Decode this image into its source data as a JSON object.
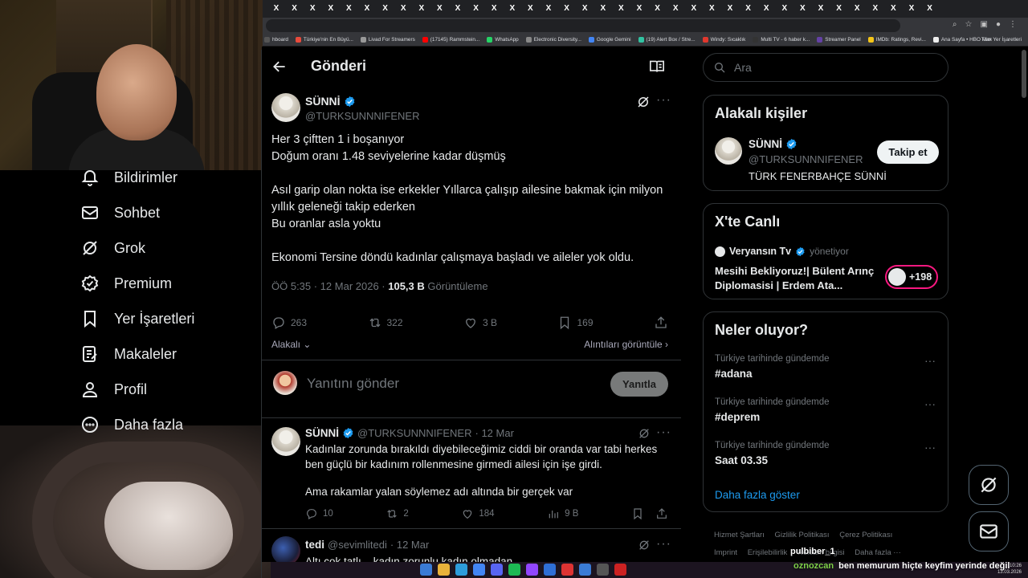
{
  "browser": {
    "tab_glyph": "X",
    "bookmarks": [
      {
        "label": "hboard",
        "color": "#555"
      },
      {
        "label": "Türkiye'nin En Büyü...",
        "color": "#e94b3c"
      },
      {
        "label": "Livad For Streamers",
        "color": "#999"
      },
      {
        "label": "(17145) Rammstein...",
        "color": "#ff0000"
      },
      {
        "label": "WhatsApp",
        "color": "#25d366"
      },
      {
        "label": "Electronic Diversity...",
        "color": "#888"
      },
      {
        "label": "Google Gemini",
        "color": "#4285f4"
      },
      {
        "label": "(19) Alert Box / Stre...",
        "color": "#31c3a2"
      },
      {
        "label": "Windy: Sıcaklık",
        "color": "#e0382e"
      },
      {
        "label": "Multi TV - 6 haber k...",
        "color": "#333"
      },
      {
        "label": "Streamer Panel",
        "color": "#6441a5"
      },
      {
        "label": "IMDb: Ratings, Revi...",
        "color": "#f5c518"
      },
      {
        "label": "Ana Sayfa • HBO Max",
        "color": "#eee"
      }
    ],
    "all_bookmarks": "Tüm Yer İşaretleri"
  },
  "left_nav": {
    "items": [
      {
        "label": "Bildirimler",
        "icon": "bell-icon"
      },
      {
        "label": "Sohbet",
        "icon": "mail-icon"
      },
      {
        "label": "Grok",
        "icon": "grok-icon"
      },
      {
        "label": "Premium",
        "icon": "premium-icon"
      },
      {
        "label": "Yer İşaretleri",
        "icon": "bookmark-icon"
      },
      {
        "label": "Makaleler",
        "icon": "article-icon"
      },
      {
        "label": "Profil",
        "icon": "profile-icon"
      },
      {
        "label": "Daha fazla",
        "icon": "more-circle-icon"
      }
    ]
  },
  "main": {
    "header": {
      "title": "Gönderi"
    },
    "post": {
      "name": "SÜNNİ",
      "handle": "@TURKSUNNNIFENER",
      "paragraphs": [
        "Her 3 çiftten 1 i boşanıyor\nDoğum oranı 1.48 seviyelerine kadar düşmüş",
        "Asıl garip olan nokta ise erkekler Yıllarca çalışıp ailesine bakmak için milyon yıllık geleneği takip ederken\nBu oranlar asla yoktu",
        "Ekonomi Tersine döndü kadınlar çalışmaya başladı ve aileler yok oldu."
      ],
      "time": "ÖÖ 5:35 · 12 Mar 2026 · ",
      "views": "105,3 B",
      "views_label": " Görüntüleme",
      "replies": "263",
      "reposts": "322",
      "likes": "3 B",
      "bookmarks": "169",
      "related": "Alakalı",
      "quotes": "Alıntıları görüntüle"
    },
    "reply_box": {
      "placeholder": "Yanıtını gönder",
      "button": "Yanıtla"
    },
    "replies": [
      {
        "name": "SÜNNİ",
        "handle": "@TURKSUNNNIFENER",
        "date": "· 12 Mar",
        "paragraphs": [
          "Kadınlar zorunda bırakıldı diyebileceğimiz ciddi bir oranda var tabi herkes ben güçlü bir kadınım rollenmesine girmedi ailesi için işe girdi.",
          "Ama rakamlar yalan söylemez adı altında bir gerçek var"
        ],
        "replies": "10",
        "reposts": "2",
        "likes": "184",
        "views": "9 B"
      },
      {
        "name": "tedi",
        "handle": "@sevimlitedi",
        "date": "· 12 Mar",
        "paragraphs": [
          "Altı çok tatlı... kadın zorunlu kadın olmadan..."
        ]
      }
    ]
  },
  "right": {
    "search_placeholder": "Ara",
    "related_people": {
      "title": "Alakalı kişiler",
      "name": "SÜNNİ",
      "handle": "@TURKSUNNNIFENER",
      "bio": "TÜRK FENERBAHÇE SÜNNİ",
      "follow": "Takip et"
    },
    "live": {
      "title": "X'te Canlı",
      "host": "Veryansın Tv",
      "host_role": "yönetiyor",
      "stream_title": "Mesihi Bekliyoruz!| Bülent Arınç Diplomasisi | Erdem Ata...",
      "listeners": "+198"
    },
    "trends": {
      "title": "Neler oluyor?",
      "items": [
        {
          "context": "Türkiye tarihinde gündemde",
          "name": "#adana"
        },
        {
          "context": "Türkiye tarihinde gündemde",
          "name": "#deprem"
        },
        {
          "context": "Türkiye tarihinde gündemde",
          "name": "Saat 03.35"
        }
      ],
      "show_more": "Daha fazla göster"
    },
    "footer": [
      "Hizmet Şartları",
      "Gizlilik Politikası",
      "Çerez Politikası",
      "Imprint",
      "Erişilebilirlik",
      "Reklam bilgisi",
      "Daha fazla ···"
    ]
  },
  "overlay": {
    "chat_user_top": "pulbiber_1",
    "chat_user": "oznozcan",
    "chat_message": "ben memurum hiçte keyfim yerinde değil"
  },
  "taskbar": {
    "time": "10:26",
    "date": "13.03.2026",
    "icon_colors": [
      "#3a7bd5",
      "#e8b23a",
      "#2d9cdb",
      "#4285f4",
      "#5865f2",
      "#1db954",
      "#9146ff",
      "#2f6fd6",
      "#d33",
      "#3a7bd5",
      "#555",
      "#c22"
    ]
  },
  "colors": {
    "accent": "#1d9bf0",
    "live": "#f91880",
    "background": "#000000"
  }
}
